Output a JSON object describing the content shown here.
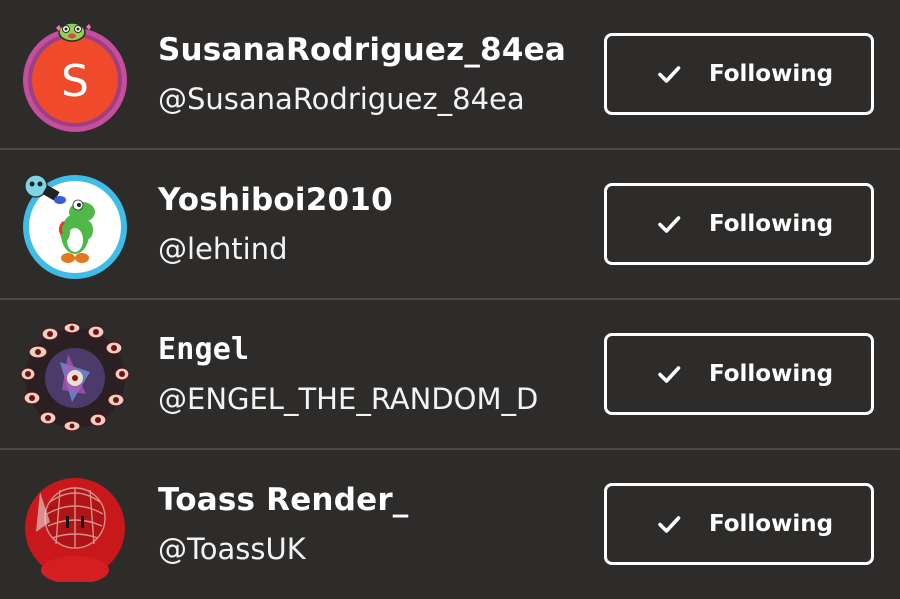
{
  "users": [
    {
      "display_name": "SusanaRodriguez_84ea",
      "handle": "@SusanaRodriguez_84ea",
      "avatar": {
        "type": "letter",
        "letter": "S",
        "bg": "#ef4a2b",
        "ring": "#c64f9c"
      },
      "button_label": "Following",
      "button_icon": "check-icon"
    },
    {
      "display_name": "Yoshiboi2010",
      "handle": "@lehtind",
      "avatar": {
        "type": "image",
        "depicts": "yoshi",
        "ring": "#3fbde6"
      },
      "button_label": "Following",
      "button_icon": "check-icon"
    },
    {
      "display_name": "Engel",
      "handle": "@ENGEL_THE_RANDOM_D",
      "avatar": {
        "type": "image",
        "depicts": "eyes-collage"
      },
      "button_label": "Following",
      "button_icon": "check-icon"
    },
    {
      "display_name": "Toass Render_",
      "handle": "@ToassUK",
      "avatar": {
        "type": "image",
        "depicts": "red-hooded-character",
        "bg": "#c8181b"
      },
      "button_label": "Following",
      "button_icon": "check-icon"
    }
  ],
  "colors": {
    "background": "#2e2c2b",
    "divider": "#4a4746",
    "text": "#ffffff",
    "button_border": "#ffffff"
  }
}
